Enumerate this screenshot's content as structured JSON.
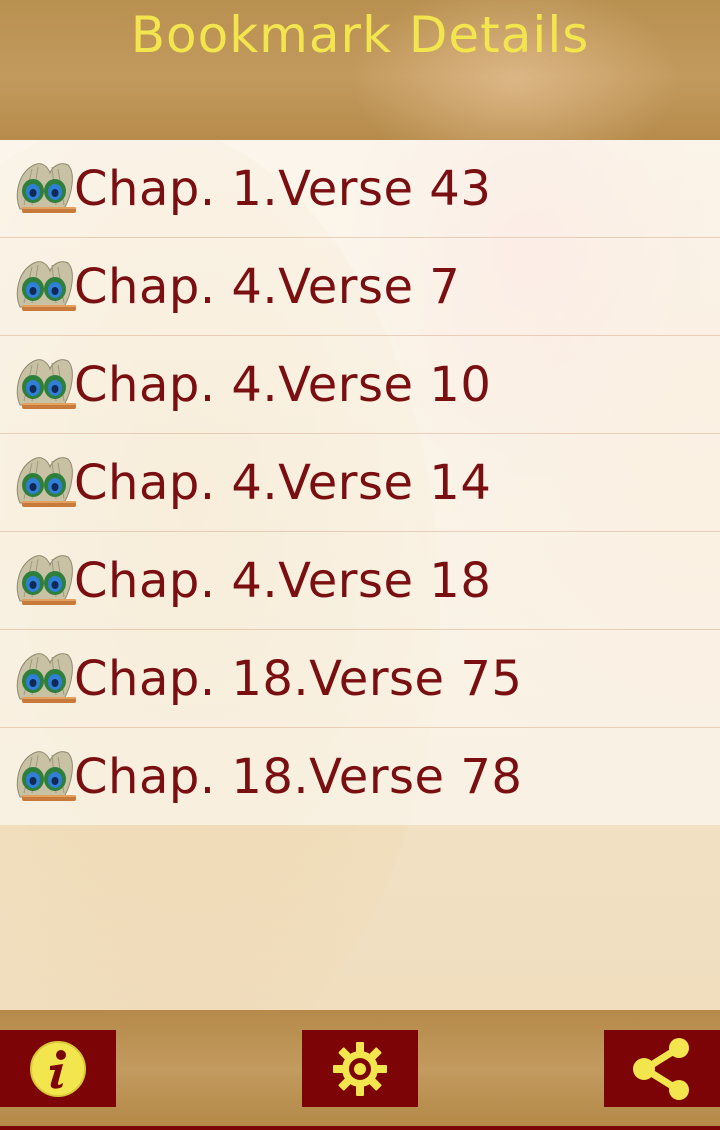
{
  "header": {
    "title": "Bookmark Details"
  },
  "bookmarks": [
    {
      "label": "Chap. 1.Verse 43"
    },
    {
      "label": "Chap. 4.Verse 7"
    },
    {
      "label": "Chap. 4.Verse 10"
    },
    {
      "label": "Chap. 4.Verse 14"
    },
    {
      "label": "Chap. 4.Verse 18"
    },
    {
      "label": "Chap. 18.Verse 75"
    },
    {
      "label": "Chap. 18.Verse 78"
    }
  ],
  "footer": {
    "info_icon": "info-icon",
    "settings_icon": "gear-icon",
    "share_icon": "share-icon"
  },
  "colors": {
    "header_title": "#f2e54d",
    "item_text": "#7a0f12",
    "button_bg": "#7c0407",
    "icon_fill": "#f2e54d"
  }
}
